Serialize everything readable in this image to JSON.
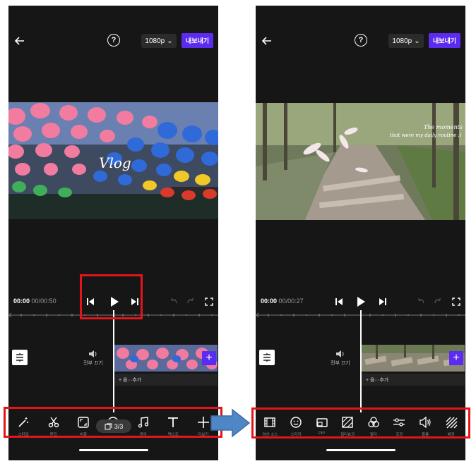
{
  "left": {
    "resolution": "1080p",
    "export_label": "내보내기",
    "time_current": "00:00",
    "time_ms": "00",
    "time_total": "/00:50",
    "overlay_text": "Vlog",
    "mute_label": "전부 끄기",
    "music_label": "+ 음···추가",
    "page_indicator": "3/3",
    "tools": [
      {
        "icon": "magic-wand-icon",
        "label": "스타일"
      },
      {
        "icon": "scissors-icon",
        "label": "편집"
      },
      {
        "icon": "ratio-icon",
        "label": "비율"
      },
      {
        "icon": "circle-icon",
        "label": ""
      },
      {
        "icon": "music-note-icon",
        "label": "음악"
      },
      {
        "icon": "text-icon",
        "label": "텍스트"
      },
      {
        "icon": "add-icon",
        "label": "더보기"
      }
    ]
  },
  "right": {
    "resolution": "1080p",
    "export_label": "내보내기",
    "time_current": "00:00",
    "time_ms": "00",
    "time_total": "/00:27",
    "caption_line1": "The moments",
    "caption_line2": "that were my daily routine :)",
    "mute_label": "전부 끄기",
    "music_label": "+ 음···추가",
    "tools": [
      {
        "icon": "film-icon",
        "label": "영상 소스"
      },
      {
        "icon": "smiley-icon",
        "label": "스티커"
      },
      {
        "icon": "pip-icon",
        "label": "PIP"
      },
      {
        "icon": "filter-icon",
        "label": "필터효과"
      },
      {
        "icon": "color-circles-icon",
        "label": "필터"
      },
      {
        "icon": "adjust-sliders-icon",
        "label": "조정"
      },
      {
        "icon": "volume-icon",
        "label": "볼륨"
      },
      {
        "icon": "stripes-icon",
        "label": "배경"
      }
    ]
  },
  "colors": {
    "accent": "#5b2cf0",
    "highlight": "#e3151a",
    "arrow": "#4f86c6",
    "background": "#161616"
  }
}
